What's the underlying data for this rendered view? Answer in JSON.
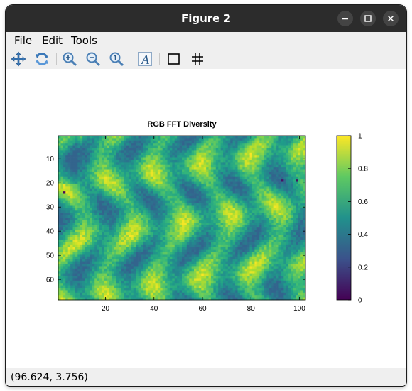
{
  "window": {
    "title": "Figure 2"
  },
  "menu": [
    {
      "label": "File"
    },
    {
      "label": "Edit"
    },
    {
      "label": "Tools"
    }
  ],
  "toolbar": {
    "tools": [
      "pan-icon",
      "rotate-icon",
      "zoom-in-icon",
      "zoom-out-icon",
      "zoom-reset-icon",
      "text-icon",
      "box-icon",
      "grid-icon"
    ]
  },
  "status": {
    "coords": "(96.624, 3.756)"
  },
  "chart_data": {
    "type": "heatmap",
    "title": "RGB FFT Diversity",
    "xlabel": "",
    "ylabel": "",
    "xlim": [
      0.5,
      102.5
    ],
    "ylim": [
      0.5,
      68.5
    ],
    "x_ticks": [
      20,
      40,
      60,
      80,
      100
    ],
    "y_ticks": [
      10,
      20,
      30,
      40,
      50,
      60
    ],
    "colorbar": {
      "range": [
        0,
        1
      ],
      "ticks": [
        0,
        0.2,
        0.4,
        0.6,
        0.8,
        1
      ],
      "colormap": "viridis"
    },
    "grid": false,
    "dimensions": {
      "cols": 102,
      "rows": 68
    },
    "notable_low_values": [
      {
        "x": 3,
        "y": 24,
        "value": 0.02
      },
      {
        "x": 93,
        "y": 19,
        "value": 0.05
      },
      {
        "x": 99,
        "y": 19,
        "value": 0.05
      }
    ]
  }
}
